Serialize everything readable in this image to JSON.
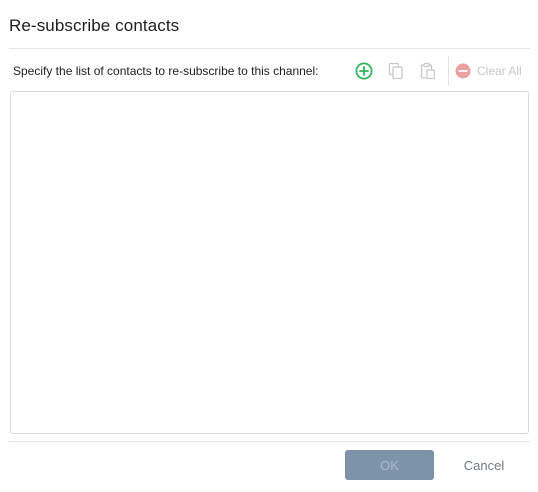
{
  "dialog": {
    "title": "Re-subscribe contacts",
    "instruction": "Specify the list of contacts to re-subscribe to this channel:"
  },
  "toolbar": {
    "add_icon": "plus-circle-icon",
    "copy_icon": "copy-icon",
    "paste_icon": "paste-icon",
    "clear_icon": "minus-circle-icon",
    "clear_all_label": "Clear All"
  },
  "contacts_list": {
    "items": []
  },
  "footer": {
    "ok_label": "OK",
    "cancel_label": "Cancel"
  },
  "colors": {
    "add_icon": "#2fb45a",
    "disabled_icon": "#c8c8c8",
    "clear_icon": "#e9a0a0",
    "ok_button_bg": "#7c93a8",
    "ok_button_text": "#a9bccd",
    "cancel_text": "#6f7b86"
  }
}
